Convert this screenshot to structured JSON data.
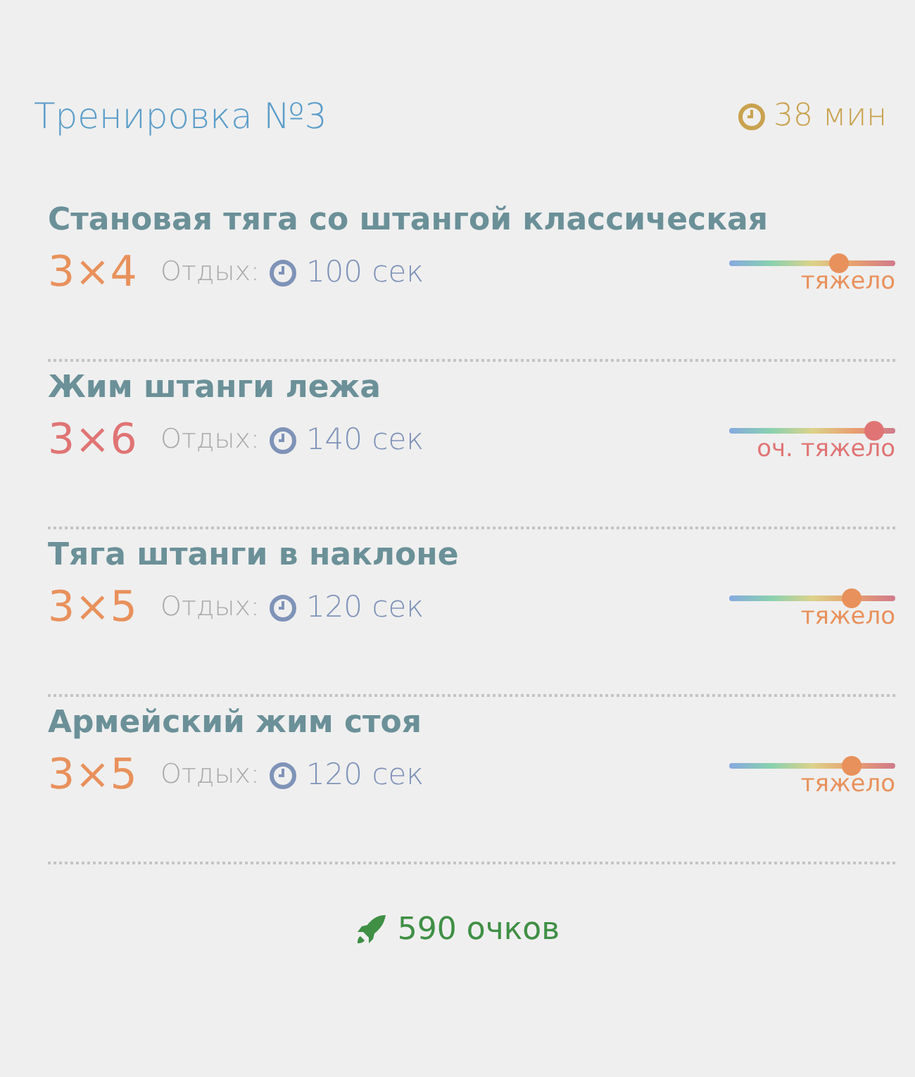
{
  "header": {
    "title": "Тренировка №3",
    "duration": "38 мин"
  },
  "exercises": [
    {
      "name": "Становая тяга со штангой классическая",
      "sets": "3×4",
      "rest_label": "Отдых:",
      "rest": "100 сек",
      "level": 0.66,
      "difficulty": "тяжело",
      "color": "#e8915c"
    },
    {
      "name": "Жим штанги лежа",
      "sets": "3×6",
      "rest_label": "Отдых:",
      "rest": "140 сек",
      "level": 0.87,
      "difficulty": "оч. тяжело",
      "color": "#e07474"
    },
    {
      "name": "Тяга штанги в наклоне",
      "sets": "3×5",
      "rest_label": "Отдых:",
      "rest": "120 сек",
      "level": 0.74,
      "difficulty": "тяжело",
      "color": "#e8915c"
    },
    {
      "name": "Армейский жим стоя",
      "sets": "3×5",
      "rest_label": "Отдых:",
      "rest": "120 сек",
      "level": 0.74,
      "difficulty": "тяжело",
      "color": "#e8915c"
    }
  ],
  "footer": {
    "points": "590 очков"
  }
}
